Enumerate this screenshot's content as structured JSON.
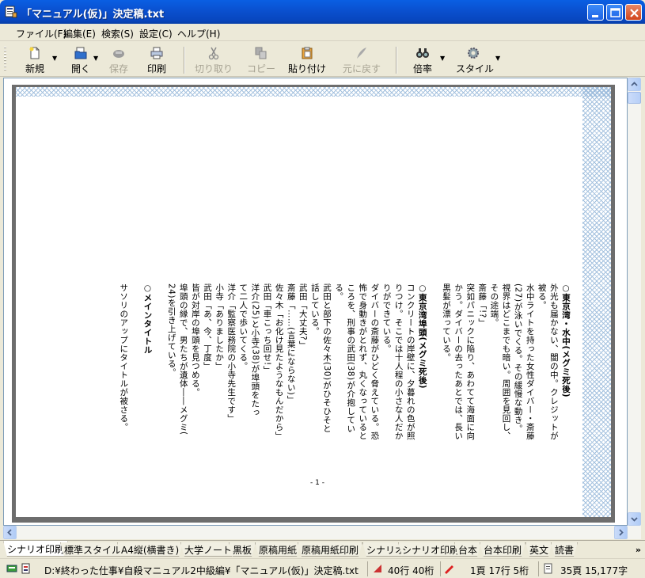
{
  "window": {
    "title": "「マニュアル(仮)」決定稿.txt"
  },
  "menu": [
    "ファイル(F)",
    "編集(E)",
    "検索(S)",
    "設定(C)",
    "ヘルプ(H)"
  ],
  "toolbar": {
    "new": "新規",
    "open": "開く",
    "save": "保存",
    "print": "印刷",
    "cut": "切り取り",
    "copy": "コピー",
    "paste": "貼り付け",
    "undo": "元に戻す",
    "zoom": "倍率",
    "style": "スタイル"
  },
  "document": {
    "lines": [
      {
        "text": "○東京湾・水中(メグミ死後)",
        "bold": true
      },
      {
        "text": "外光も届かない、闇の中。クレジットが",
        "bold": false
      },
      {
        "text": "被る。",
        "bold": false
      },
      {
        "text": "水中ライトを持った女性ダイバー・斎藤",
        "bold": false
      },
      {
        "text": "(27)が泳いでくる。その緩慢な動き。",
        "bold": false
      },
      {
        "text": "視界はどこまでも暗い。周囲を見回し、",
        "bold": false
      },
      {
        "text": "その途端。",
        "bold": false
      },
      {
        "text": "斎藤「!?」",
        "bold": false
      },
      {
        "text": "突如パニックに陥り、あわてて海面に向",
        "bold": false
      },
      {
        "text": "かう。ダイバーの去ったあとでは、長い",
        "bold": false
      },
      {
        "text": "黒髪が漂っている。",
        "bold": false
      },
      {
        "text": "",
        "bold": false
      },
      {
        "text": "○東京湾埠頭(メグミ死後)",
        "bold": true
      },
      {
        "text": "コンクリートの岸壁に、夕暮れの色が照",
        "bold": false
      },
      {
        "text": "りつけ。そこでは十人程の小さな人だか",
        "bold": false
      },
      {
        "text": "りができている。",
        "bold": false
      },
      {
        "text": "ダイバーの斎藤がひどく脅えている。恐",
        "bold": false
      },
      {
        "text": "怖で身動きがとれず、丸くなっていると",
        "bold": false
      },
      {
        "text": "ころを、刑事の武田(38)が介抱してい",
        "bold": false
      },
      {
        "text": "る。",
        "bold": false
      },
      {
        "text": "武田と部下の佐々木(30)がひそひそと",
        "bold": false
      },
      {
        "text": "話している。",
        "bold": false
      },
      {
        "text": "武田「大丈夫?」",
        "bold": false
      },
      {
        "text": "斎藤「……(言葉にならない)」",
        "bold": false
      },
      {
        "text": "佐々木「お化け見たようなもんだから」",
        "bold": false
      },
      {
        "text": "武田「車こっち回せ!」",
        "bold": false
      },
      {
        "text": "洋介(25)と小寺(38)が埠頭をたっ",
        "bold": false
      },
      {
        "text": "て二人で歩いてくる。",
        "bold": false
      },
      {
        "text": "洋介「監察医務院の小寺先生です」",
        "bold": false
      },
      {
        "text": "小寺「ありましたか」",
        "bold": false
      },
      {
        "text": "武田「あ、今、丁度」",
        "bold": false
      },
      {
        "text": "皆が対岸の埠頭を見つめる。",
        "bold": false
      },
      {
        "text": "埠頭の縁で、男たちが遺体――メグミ(",
        "bold": false
      },
      {
        "text": "24)を引き上げている。",
        "bold": false
      },
      {
        "text": "",
        "bold": false
      },
      {
        "text": "○メインタイトル",
        "bold": true
      },
      {
        "text": "",
        "bold": false
      },
      {
        "text": "サソリのアップにタイトルが被さる。",
        "bold": false
      }
    ],
    "page_number": "- 1 -"
  },
  "style_tabs": [
    "シナリオ印刷",
    "標準スタイル",
    "A4縦(横書き)",
    "大学ノート",
    "黒板",
    "原稿用紙",
    "原稿用紙印刷",
    "シナリオ",
    "シナリオ印刷",
    "台本",
    "台本印刷",
    "英文",
    "読書"
  ],
  "status": {
    "path": "D:¥終わった仕事¥自殺マニュアル2中級編¥「マニュアル(仮)」決定稿.txt",
    "grid": "40行 40桁",
    "position": "1頁 17行 5桁",
    "totals": "35頁 15,177字"
  },
  "colors": {
    "titlebar": "#0A50CF",
    "chrome": "#ECE9D8",
    "hatch": "#8FB4D8"
  }
}
